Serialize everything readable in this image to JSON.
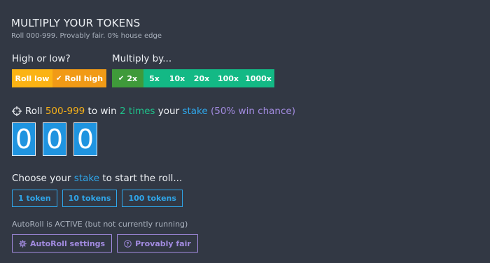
{
  "header": {
    "title": "MULTIPLY YOUR TOKENS",
    "subtitle": "Roll 000-999. Provably fair. 0% house edge"
  },
  "hilo": {
    "label": "High or low?",
    "low_label": "Roll low",
    "high_label": "Roll high",
    "selected": "high"
  },
  "multiplier": {
    "label": "Multiply by...",
    "options": [
      "2x",
      "5x",
      "10x",
      "20x",
      "100x",
      "1000x"
    ],
    "selected": "2x"
  },
  "roll_info": {
    "prefix": "Roll",
    "range": "500-999",
    "to_win": "to win",
    "times": "2 times",
    "your": "your",
    "stake": "stake",
    "chance": "(50% win chance)"
  },
  "digits": [
    "0",
    "0",
    "0"
  ],
  "stake_section": {
    "choose_prefix": "Choose your",
    "stake_word": "stake",
    "choose_suffix": "to start the roll...",
    "options": [
      "1 token",
      "10 tokens",
      "100 tokens"
    ]
  },
  "autoroll": {
    "status": "AutoRoll is ACTIVE (but not currently running)",
    "settings_label": "AutoRoll settings",
    "fair_label": "Provably fair"
  },
  "colors": {
    "background": "#323844",
    "orange": "#f6b019",
    "green": "#13b985",
    "active_green": "#3f9a3a",
    "blue": "#2fa6ea",
    "purple": "#a28be0"
  },
  "icons": {
    "roll": "crosshair-icon",
    "check": "check-icon",
    "settings": "gear-icon",
    "fair": "question-circle-icon"
  }
}
